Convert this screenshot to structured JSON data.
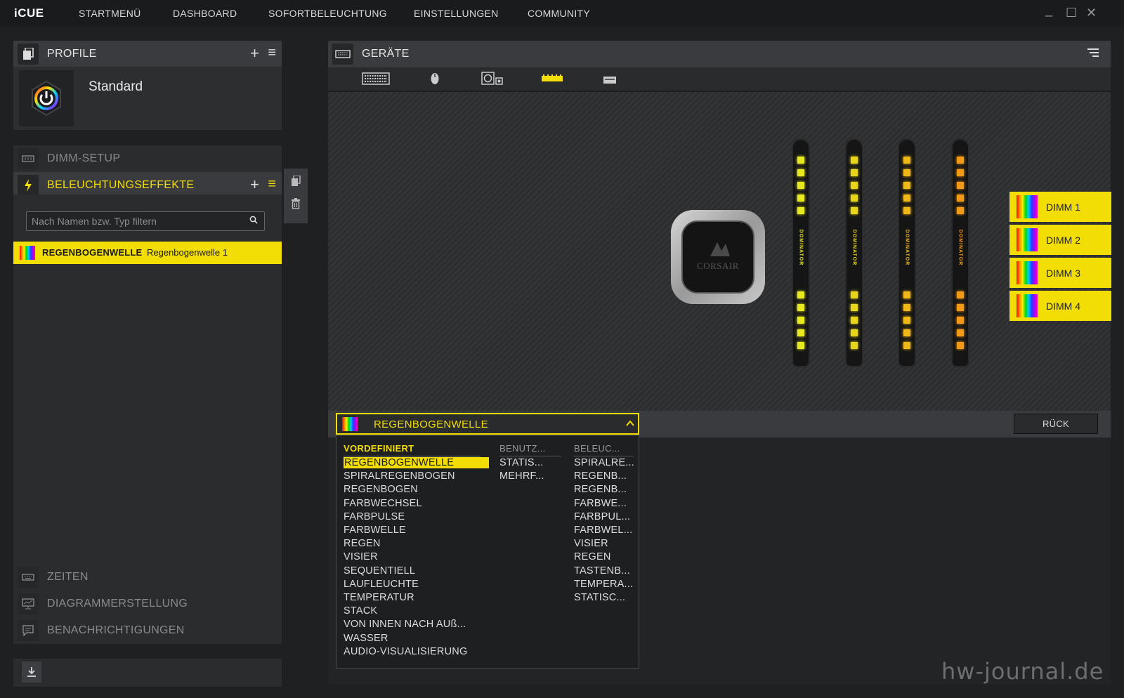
{
  "app": {
    "logo": "iCUE"
  },
  "nav": [
    "STARTMENÜ",
    "DASHBOARD",
    "SOFORTBELEUCHTUNG",
    "EINSTELLUNGEN",
    "COMMUNITY"
  ],
  "window_controls": {
    "minimize": "_",
    "maximize": "☐",
    "close": "✕"
  },
  "profile": {
    "header": "PROFILE",
    "name": "Standard"
  },
  "dimm_setup": {
    "label": "DIMM-SETUP"
  },
  "effects": {
    "header": "BELEUCHTUNGSEFFEKTE",
    "search_placeholder": "Nach Namen bzw. Typ filtern",
    "items": [
      {
        "type": "REGENBOGENWELLE",
        "name": "Regenbogenwelle 1"
      }
    ]
  },
  "bottom_sections": [
    "ZEITEN",
    "DIAGRAMMERSTELLUNG",
    "BENACHRICHTIGUNGEN"
  ],
  "devices": {
    "header": "GERÄTE"
  },
  "cooler_logo": "CORSAIR",
  "ram_stick_label": "DOMINATOR",
  "dimms": [
    "DIMM 1",
    "DIMM 2",
    "DIMM 3",
    "DIMM 4"
  ],
  "dropdown": {
    "selected": "REGENBOGENWELLE",
    "columns": [
      "VORDEFINIERT",
      "BENUTZ...",
      "BELEUC..."
    ],
    "predefined": [
      "REGENBOGENWELLE",
      "SPIRALREGENBOGEN",
      "REGENBOGEN",
      "FARBWECHSEL",
      "FARBPULSE",
      "FARBWELLE",
      "REGEN",
      "VISIER",
      "SEQUENTIELL",
      "LAUFLEUCHTE",
      "TEMPERATUR",
      "STACK",
      "VON INNEN NACH AUß...",
      "WASSER",
      "AUDIO-VISUALISIERUNG"
    ],
    "user": [
      "STATIS...",
      "MEHRF..."
    ],
    "lighting": [
      "SPIRALRE...",
      "REGENB...",
      "REGENB...",
      "FARBWE...",
      "FARBPUL...",
      "FARBWEL...",
      "VISIER",
      "REGEN",
      "TASTENB...",
      "TEMPERA...",
      "STATISC..."
    ]
  },
  "back_button": "RÜCK",
  "watermark": "hw-journal.de",
  "colors": {
    "accent": "#f2dd05",
    "panel": "#3a3b3e",
    "background": "#1f2022"
  }
}
